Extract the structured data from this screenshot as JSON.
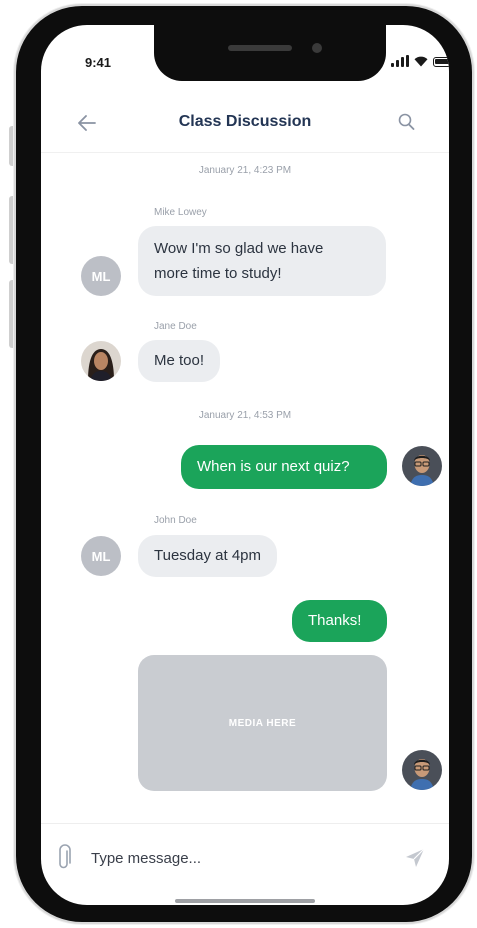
{
  "status_bar": {
    "time": "9:41"
  },
  "header": {
    "title": "Class Discussion"
  },
  "messages": [
    {
      "type": "timestamp",
      "text": "January 21, 4:23 PM"
    },
    {
      "type": "incoming",
      "sender": "Mike Lowey",
      "initials": "ML",
      "text_lines": [
        "Wow I'm so glad we have",
        "more time to study!"
      ]
    },
    {
      "type": "incoming",
      "sender": "Jane Doe",
      "text": "Me too!"
    },
    {
      "type": "timestamp",
      "text": "January 21, 4:53 PM"
    },
    {
      "type": "outgoing",
      "text": "When is our next quiz?"
    },
    {
      "type": "incoming",
      "sender": "John Doe",
      "initials": "ML",
      "text": "Tuesday at 4pm"
    },
    {
      "type": "outgoing",
      "text": "Thanks!"
    },
    {
      "type": "outgoing-media",
      "label": "MEDIA HERE"
    }
  ],
  "composer": {
    "placeholder": "Type message..."
  },
  "colors": {
    "accent": "#1ba45a",
    "title": "#233554",
    "incoming_bubble": "#ebedf0",
    "media_placeholder": "#c9ccd1"
  }
}
